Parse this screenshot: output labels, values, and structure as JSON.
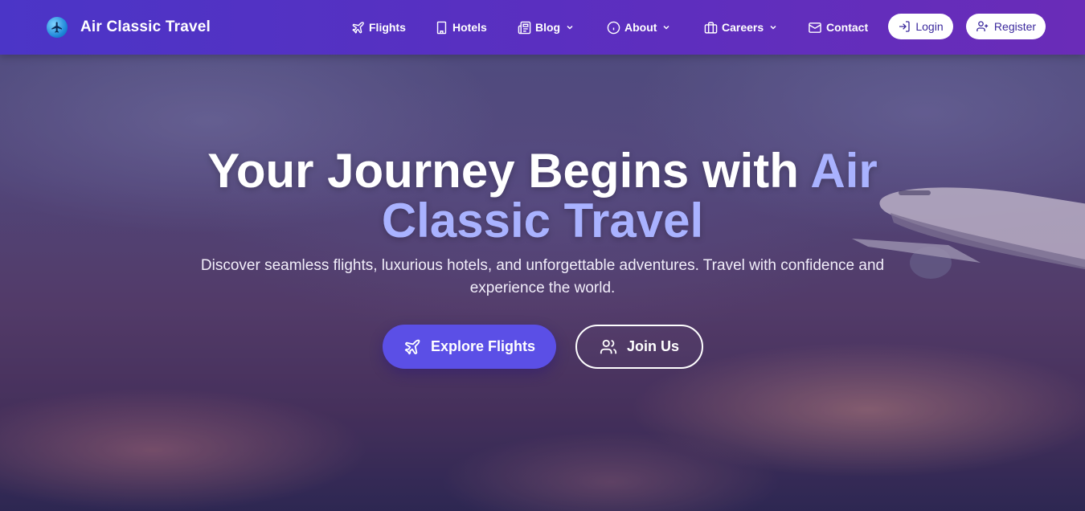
{
  "brand": {
    "name": "Air Classic Travel"
  },
  "nav": {
    "flights": "Flights",
    "hotels": "Hotels",
    "blog": "Blog",
    "about": "About",
    "careers": "Careers",
    "contact": "Contact"
  },
  "auth": {
    "login": "Login",
    "register": "Register"
  },
  "hero": {
    "headline_part1": "Your Journey Begins with ",
    "headline_accent_line1": "Air",
    "headline_accent_line2": "Classic Travel",
    "subtext": "Discover seamless flights, luxurious hotels, and unforgettable adventures. Travel with confidence and experience the world.",
    "primary_cta": "Explore Flights",
    "secondary_cta": "Join Us"
  },
  "icons": {
    "brand": "globe-airplane-icon",
    "flights": "airplane-icon",
    "hotels": "building-icon",
    "blog": "newspaper-icon",
    "about": "info-circle-icon",
    "careers": "briefcase-icon",
    "contact": "envelope-icon",
    "login": "login-arrow-icon",
    "register": "user-plus-icon",
    "join": "users-icon",
    "dropdown": "chevron-down-icon"
  },
  "colors": {
    "nav_start": "#4b35c7",
    "nav_end": "#6a2cb8",
    "accent_text": "#a9b2ff",
    "primary_button": "#5b4fe6"
  }
}
